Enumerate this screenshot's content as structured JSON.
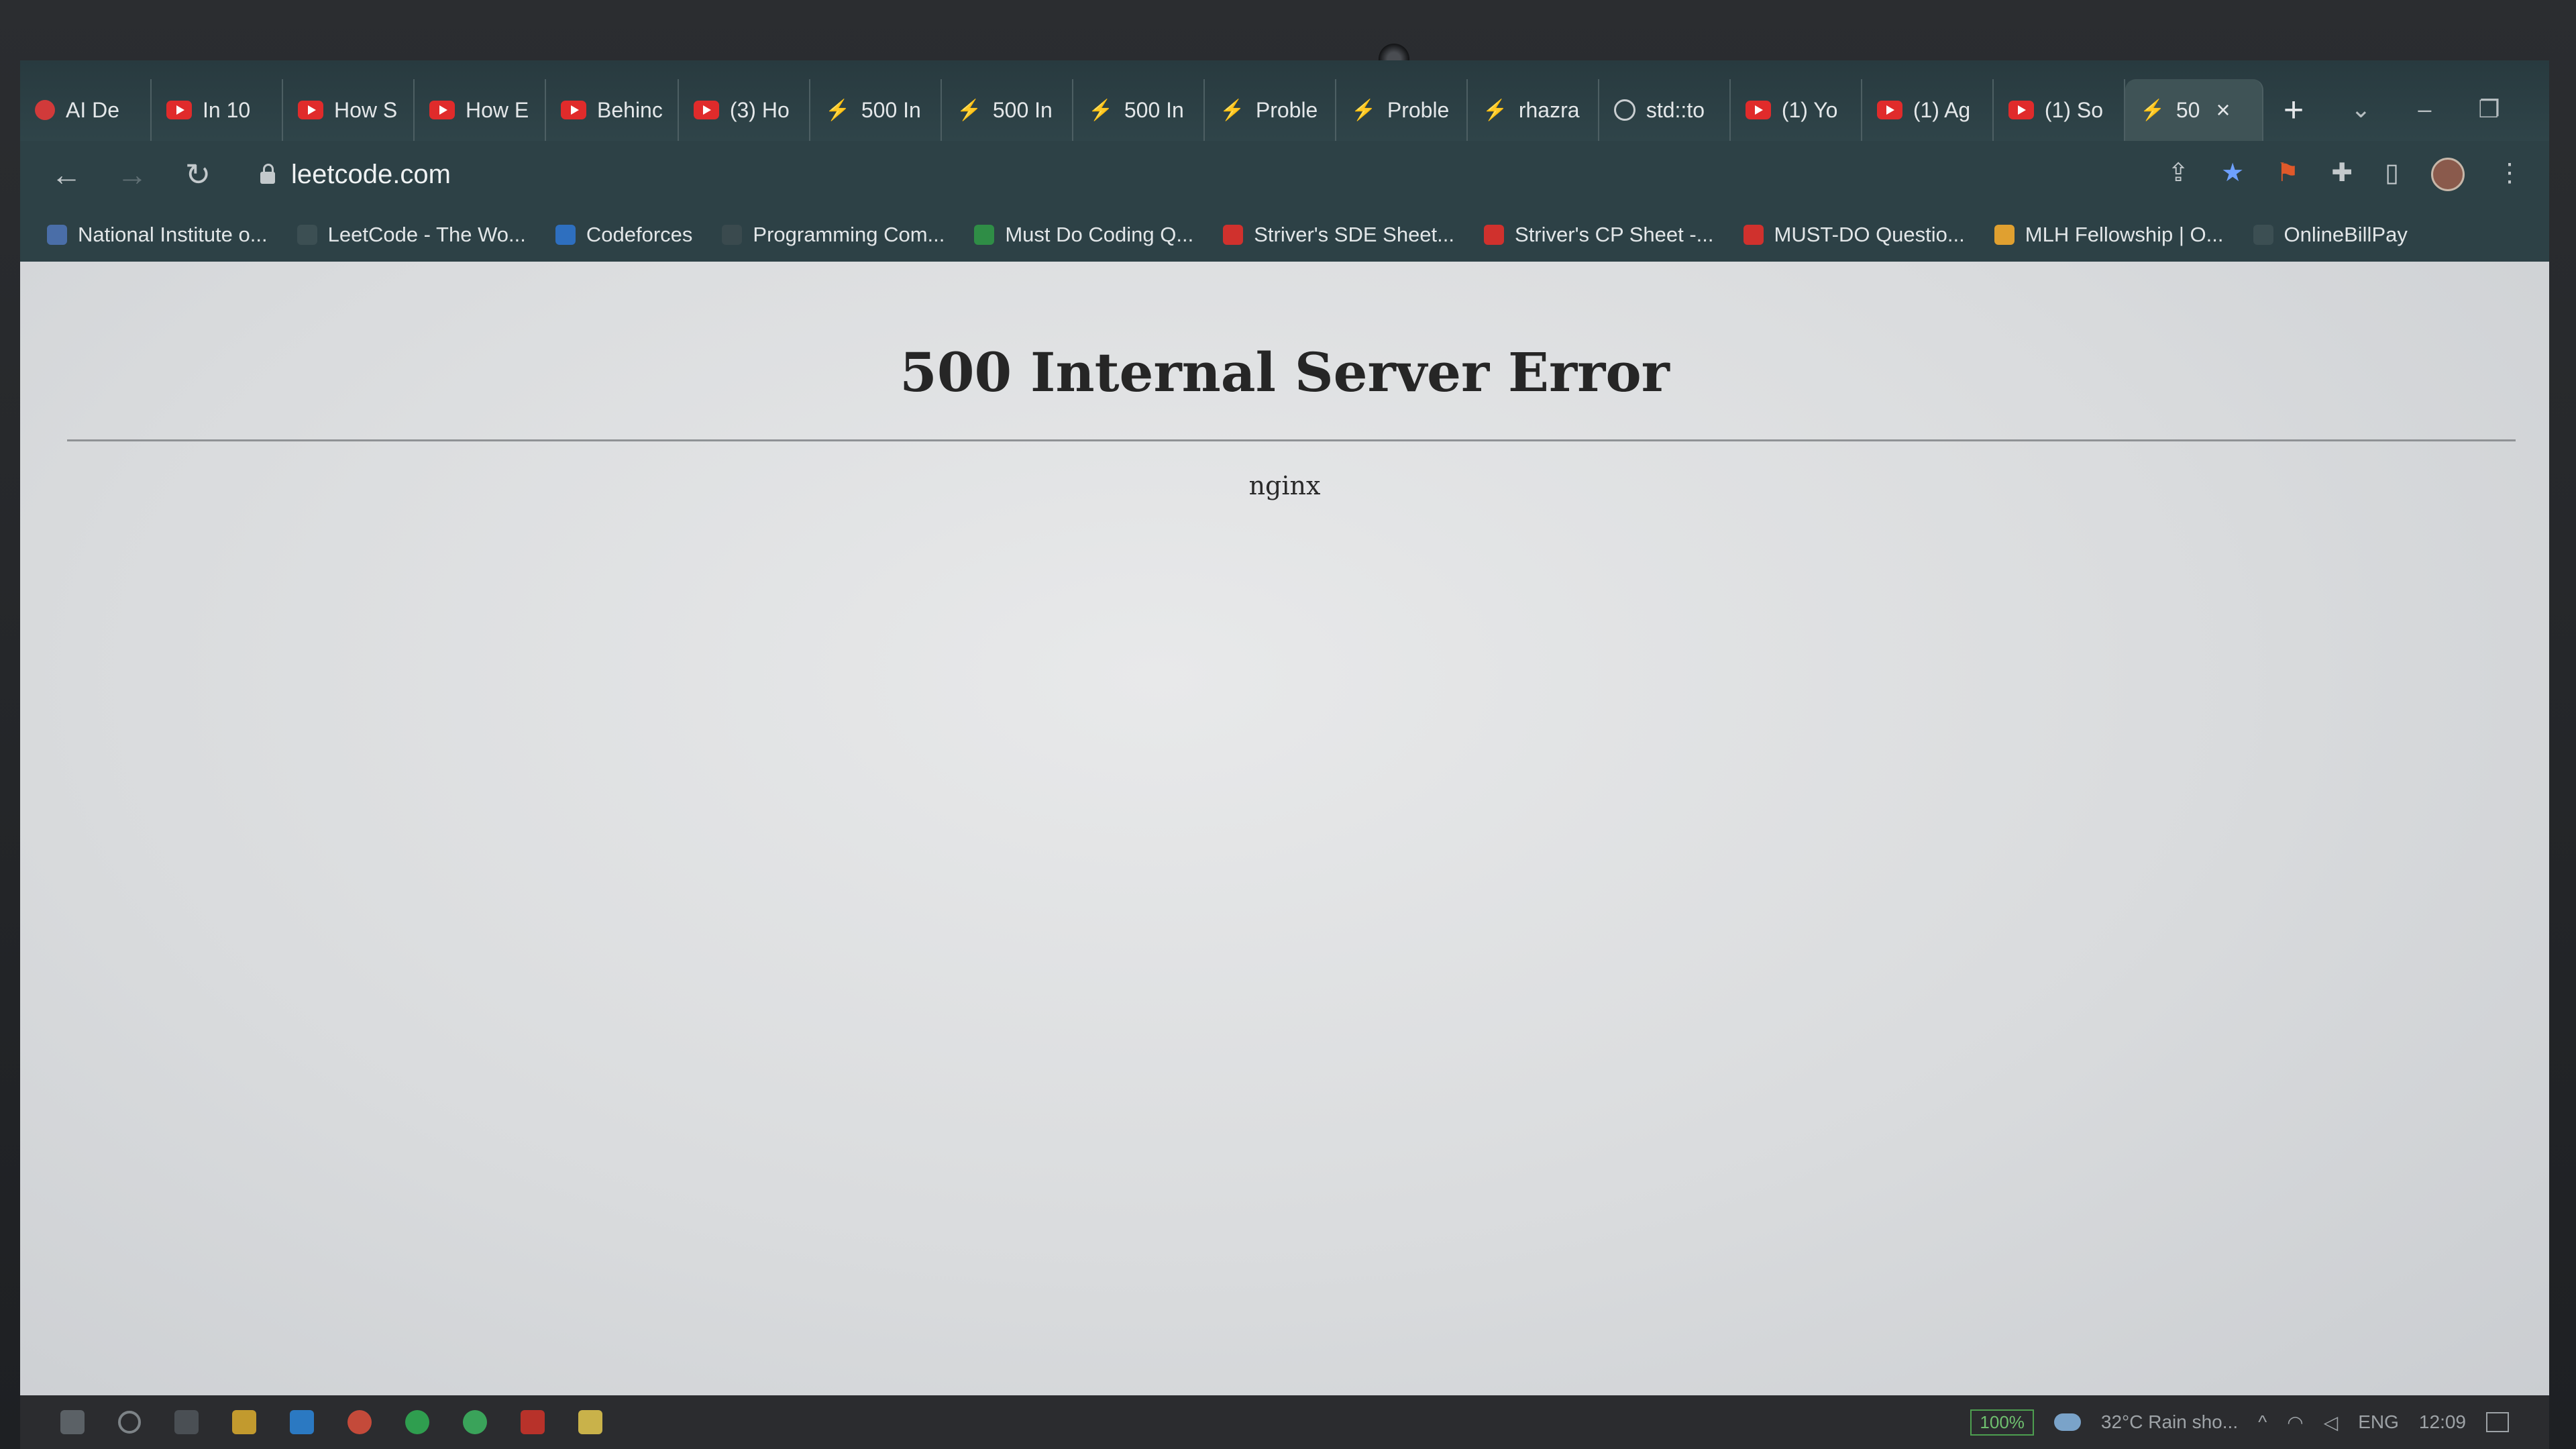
{
  "browser": {
    "tabs": [
      {
        "title": "AI De",
        "icon": "generic-icon",
        "active": false
      },
      {
        "title": "In 10",
        "icon": "youtube-icon",
        "active": false
      },
      {
        "title": "How S",
        "icon": "youtube-icon",
        "active": false
      },
      {
        "title": "How E",
        "icon": "youtube-icon",
        "active": false
      },
      {
        "title": "Behinc",
        "icon": "youtube-icon",
        "active": false
      },
      {
        "title": "(3) Ho",
        "icon": "youtube-icon",
        "active": false
      },
      {
        "title": "500 In",
        "icon": "leetcode-icon",
        "active": false
      },
      {
        "title": "500 In",
        "icon": "leetcode-icon",
        "active": false
      },
      {
        "title": "500 In",
        "icon": "leetcode-icon",
        "active": false
      },
      {
        "title": "Proble",
        "icon": "leetcode-icon",
        "active": false
      },
      {
        "title": "Proble",
        "icon": "leetcode-icon",
        "active": false
      },
      {
        "title": "rhazra",
        "icon": "leetcode-icon",
        "active": false
      },
      {
        "title": "std::to",
        "icon": "github-icon",
        "active": false
      },
      {
        "title": "(1) Yo",
        "icon": "youtube-icon",
        "active": false
      },
      {
        "title": "(1) Ag",
        "icon": "youtube-icon",
        "active": false
      },
      {
        "title": "(1) So",
        "icon": "youtube-icon",
        "active": false
      },
      {
        "title": "50",
        "icon": "leetcode-icon",
        "active": true
      }
    ],
    "new_tab_label": "+",
    "close_tab_label": "×",
    "url": "leetcode.com",
    "bookmarks": [
      {
        "label": "National Institute o...",
        "color": "#4a6ea8"
      },
      {
        "label": "LeetCode - The Wo...",
        "color": "#3c4f53"
      },
      {
        "label": "Codeforces",
        "color": "#2e6fbf"
      },
      {
        "label": "Programming Com...",
        "color": "#3a4a4e"
      },
      {
        "label": "Must Do Coding Q...",
        "color": "#2f8d46"
      },
      {
        "label": "Striver's SDE Sheet...",
        "color": "#d0312d"
      },
      {
        "label": "Striver's CP Sheet -...",
        "color": "#d0312d"
      },
      {
        "label": "MUST-DO Questio...",
        "color": "#d0312d"
      },
      {
        "label": "MLH Fellowship | O...",
        "color": "#e0a030"
      },
      {
        "label": "OnlineBillPay",
        "color": "#3c4f53"
      }
    ]
  },
  "page": {
    "title": "500 Internal Server Error",
    "server": "nginx"
  },
  "taskbar": {
    "battery": "100%",
    "weather": "32°C  Rain sho...",
    "language": "ENG",
    "time": "12:09"
  }
}
